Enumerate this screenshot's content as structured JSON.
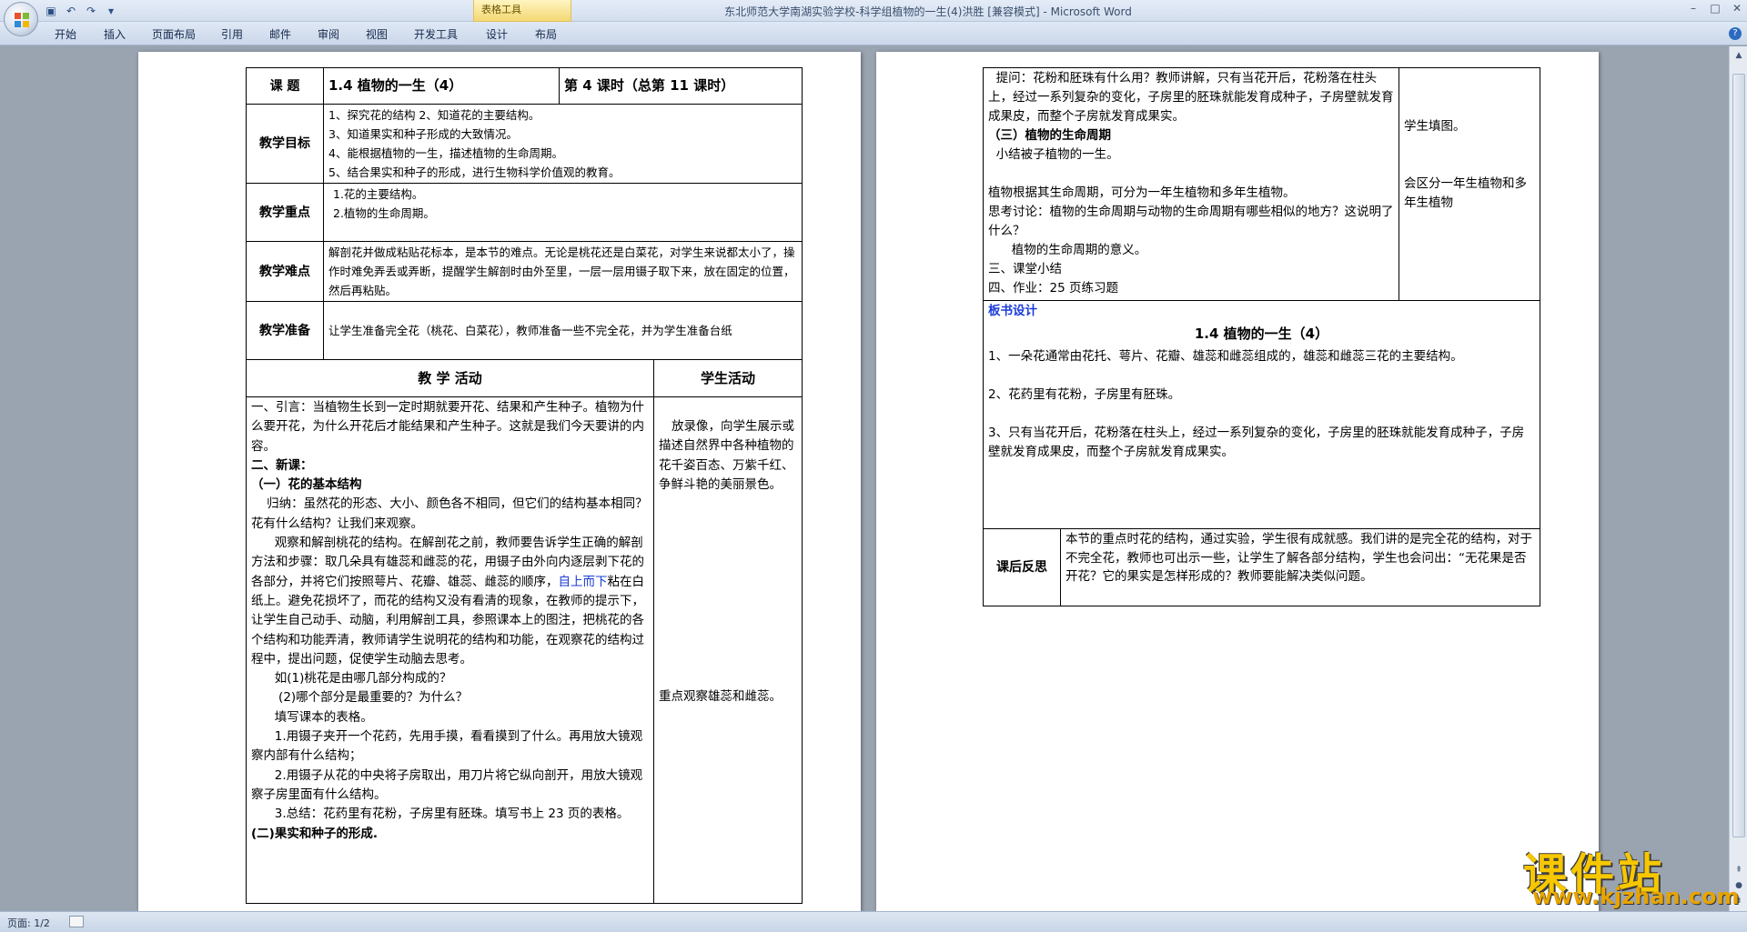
{
  "window": {
    "title": "东北师范大学南湖实验学校-科学组植物的一生(4)洪胜 [兼容模式] - Microsoft Word",
    "table_tools": "表格工具"
  },
  "ribbon": {
    "tabs": [
      "开始",
      "插入",
      "页面布局",
      "引用",
      "邮件",
      "审阅",
      "视图",
      "开发工具",
      "设计",
      "布局"
    ]
  },
  "status": {
    "page": "页面: 1/2"
  },
  "watermark": {
    "brand": "课件站",
    "url": "www.kjzhan.com"
  },
  "page1": {
    "topic_label": "课  题",
    "topic": "1.4 植物的一生（4）",
    "period": "第   4  课时（总第  11  课时）",
    "goals_label": "教学目标",
    "goals": [
      "1、探究花的结构 2、知道花的主要结构。",
      "3、知道果实和种子形成的大致情况。",
      "4、能根据植物的一生，描述植物的生命周期。",
      "5、结合果实和种子的形成，进行生物科学价值观的教育。"
    ],
    "key_label": "教学重点",
    "keys": [
      "1.花的主要结构。",
      "2.植物的生命周期。"
    ],
    "diff_label": "教学难点",
    "difficulty": "解剖花并做成粘贴花标本，是本节的难点。无论是桃花还是白菜花，对学生来说都太小了，操作时难免弄丢或弄断，提醒学生解剖时由外至里，一层一层用镊子取下来，放在固定的位置，然后再粘贴。",
    "prep_label": "教学准备",
    "prep": "让学生准备完全花（桃花、白菜花），教师准备一些不完全花，并为学生准备台纸",
    "activity_header": "教 学 活动",
    "student_header": "学生活动",
    "activities": [
      "一、引言：当植物生长到一定时期就要开花、结果和产生种子。植物为什么要开花，为什么开花后才能结果和产生种子。这就是我们今天要讲的内容。",
      "二、新课：",
      "（一）花的基本结构",
      "    归纳：虽然花的形态、大小、颜色各不相同，但它们的结构基本相同？花有什么结构？让我们来观察。",
      "      观察和解剖桃花的结构。在解剖花之前，教师要告诉学生正确的解剖方法和步骤：取几朵具有雄蕊和雌蕊的花，用镊子由外向内逐层剥下花的各部分，并将它们按照萼片、花瓣、雄蕊、雌蕊的顺序，",
      "自上而下",
      "粘在白纸上。避免花损坏了，而花的结构又没有看清的现象，在教师的提示下，让学生自己动手、动脑，利用解剖工具，参照课本上的图注，把桃花的各个结构和功能弄清，教师请学生说明花的结构和功能，在观察花的结构过程中，提出问题，促使学生动脑去思考。",
      "      如(1)桃花是由哪几部分构成的？",
      "       (2)哪个部分是最重要的？为什么？",
      "      填写课本的表格。",
      "      1.用镊子夹开一个花药，先用手摸，看看摸到了什么。再用放大镜观察内部有什么结构；",
      "      2.用镊子从花的中央将子房取出，用刀片将它纵向剖开，用放大镜观察子房里面有什么结构。",
      "      3.总结：花药里有花粉，子房里有胚珠。填写书上 23 页的表格。",
      "(二)果实和种子的形成."
    ],
    "student_1": "放录像，向学生展示或描述自然界中各种植物的花千姿百态、万紫千红、争鲜斗艳的美丽景色。",
    "student_2": "重点观察雄蕊和雌蕊。"
  },
  "page2": {
    "cont": [
      "  提问：花粉和胚珠有什么用？教师讲解，只有当花开后，花粉落在柱头上，经过一系列复杂的变化，子房里的胚珠就能发育成种子，子房壁就发育成果皮，而整个子房就发育成果实。",
      "（三）植物的生命周期",
      "  小结被子植物的一生。",
      "",
      "植物根据其生命周期，可分为一年生植物和多年生植物。",
      "思考讨论：植物的生命周期与动物的生命周期有哪些相似的地方？这说明了什么？",
      "      植物的生命周期的意义。",
      "三、课堂小结",
      "四、作业：25 页练习题"
    ],
    "student_a": "学生填图。",
    "student_b": "会区分一年生植物和多年生植物",
    "board_label": "板书设计",
    "board_title": "1.4 植物的一生（4）",
    "board": [
      "1、一朵花通常由花托、萼片、花瓣、雄蕊和雌蕊组成的，雄蕊和雌蕊三花的主要结构。",
      "2、花药里有花粉，子房里有胚珠。",
      "3、只有当花开后，花粉落在柱头上，经过一系列复杂的变化，子房里的胚珠就能发育成种子，子房壁就发育成果皮，而整个子房就发育成果实。"
    ],
    "reflect_label": "课后反思",
    "reflect": "本节的重点时花的结构，通过实验，学生很有成就感。我们讲的是完全花的结构，对于不完全花，教师也可出示一些，让学生了解各部分结构，学生也会问出：“无花果是否开花？它的果实是怎样形成的？教师要能解决类似问题。"
  }
}
